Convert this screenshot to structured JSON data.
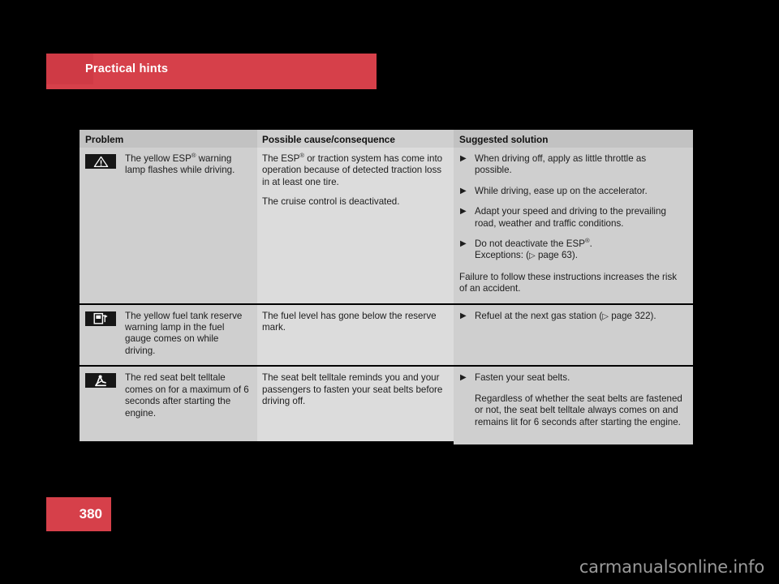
{
  "header": {
    "chapter_title": "Practical hints",
    "bar_color": "#d6404a",
    "tab_color": "#cf3a45"
  },
  "table": {
    "columns": [
      {
        "label": "Problem"
      },
      {
        "label": "Possible cause/consequence"
      },
      {
        "label": "Suggested solution"
      }
    ],
    "rows": [
      {
        "icon": "warning-triangle-icon",
        "problem": "The yellow ESP® warning lamp flashes while driving.",
        "problem_pre": "The yellow ESP",
        "problem_sup": "®",
        "problem_post": " warning lamp flashes while driving.",
        "cause": {
          "paragraphs": [
            {
              "pre": "The ESP",
              "sup": "®",
              "post": " or traction system has come into operation because of detected traction loss in at least one tire."
            },
            {
              "pre": "The cruise control is deactivated.",
              "sup": "",
              "post": ""
            }
          ]
        },
        "solution": {
          "bullets": [
            {
              "pre": "When driving off, apply as little throttle as possible.",
              "sup": "",
              "post": ""
            },
            {
              "pre": "While driving, ease up on the accelerator.",
              "sup": "",
              "post": ""
            },
            {
              "pre": "Adapt your speed and driving to the prevailing road, weather and traffic conditions.",
              "sup": "",
              "post": ""
            },
            {
              "pre": "Do not deactivate the ESP",
              "sup": "®",
              "post": ".\nExceptions: (▷ page 63)."
            }
          ],
          "tail": "Failure to follow these instructions increases the risk of an accident.",
          "tail_indent": false
        }
      },
      {
        "icon": "fuel-pump-icon",
        "problem": "The yellow fuel tank reserve warning lamp in the fuel gauge comes on while driving.",
        "problem_pre": "The yellow fuel tank reserve warning lamp in the fuel gauge comes on while driving.",
        "problem_sup": "",
        "problem_post": "",
        "cause": {
          "paragraphs": [
            {
              "pre": "The fuel level has gone below the reserve mark.",
              "sup": "",
              "post": ""
            }
          ]
        },
        "solution": {
          "bullets": [
            {
              "pre": "Refuel at the next gas station (▷ page 322).",
              "sup": "",
              "post": ""
            }
          ],
          "tail": "",
          "tail_indent": false
        }
      },
      {
        "icon": "seat-belt-telltale-icon",
        "problem": "The red seat belt telltale comes on for a maximum of 6 seconds after starting the engine.",
        "problem_pre": "The red seat belt telltale comes on for a maximum of 6 seconds after starting the engine.",
        "problem_sup": "",
        "problem_post": "",
        "cause": {
          "paragraphs": [
            {
              "pre": "The seat belt telltale reminds you and your passengers to fasten your seat belts before driving off.",
              "sup": "",
              "post": ""
            }
          ]
        },
        "solution": {
          "bullets": [
            {
              "pre": "Fasten your seat belts.",
              "sup": "",
              "post": ""
            }
          ],
          "tail": "Regardless of whether the seat belts are fastened or not, the seat belt telltale always comes on and remains lit for 6 seconds after starting the engine.",
          "tail_indent": true
        }
      }
    ],
    "bullet_glyph": "▶",
    "pageref_glyph": "▷"
  },
  "footer": {
    "page_number": "380",
    "page_color": "#d6404a"
  },
  "watermark": {
    "text": "carmanualsonline.info"
  }
}
